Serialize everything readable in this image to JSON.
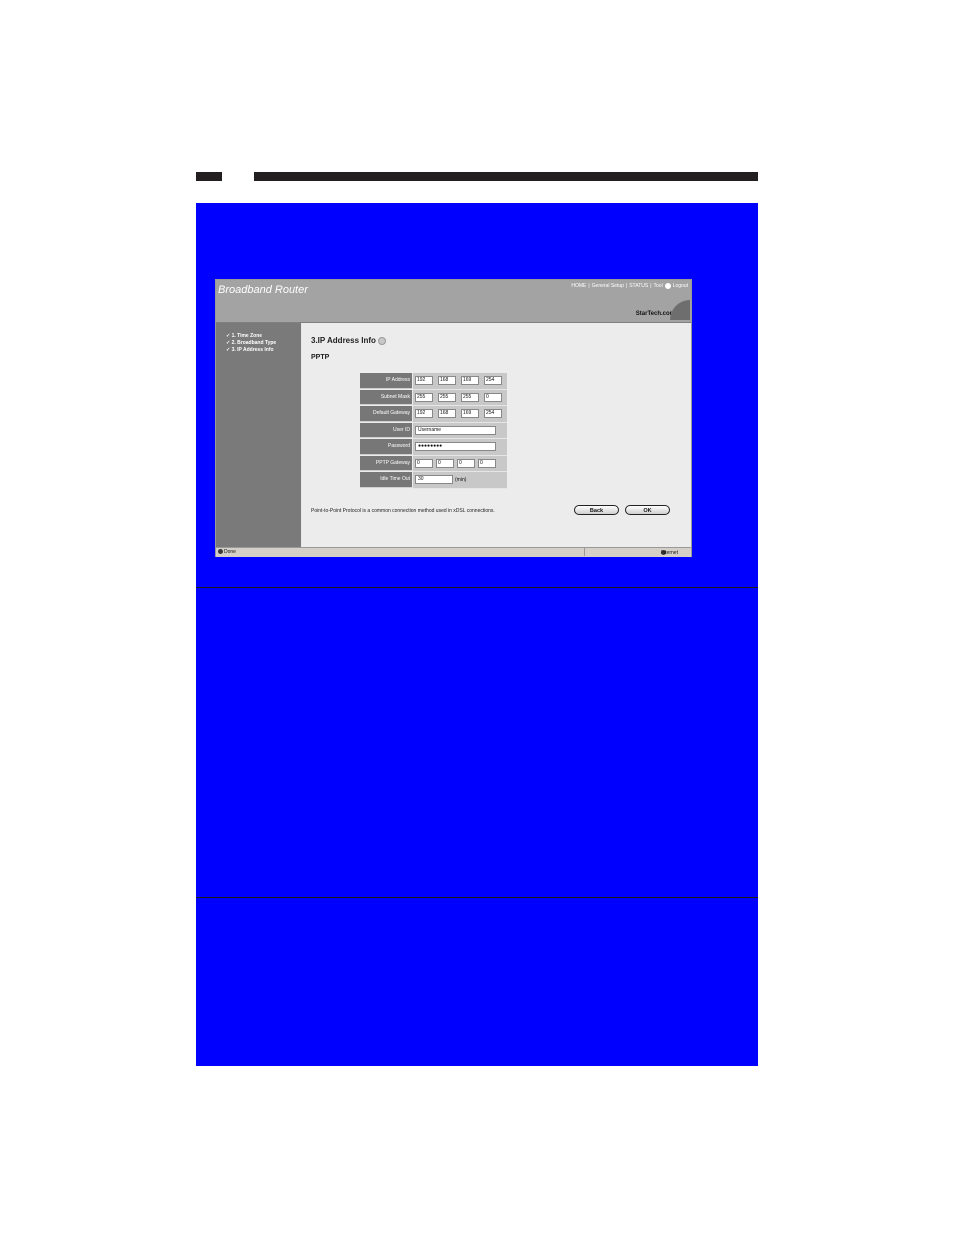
{
  "window": {
    "title": "Broadband Router",
    "nav": {
      "home": "HOME",
      "sep1": "|",
      "general_setup": "General Setup",
      "sep2": "|",
      "status": "STATUS",
      "sep3": "|",
      "tool": "Tool",
      "logout": "Logout"
    },
    "logo_text": "StarTech.com"
  },
  "sidebar": {
    "items": [
      {
        "label": "✓ 1. Time Zone"
      },
      {
        "label": "✓ 2. Broadband Type"
      },
      {
        "label": "✓ 3. IP Address Info"
      }
    ]
  },
  "main": {
    "heading": "3.IP Address Info",
    "section": "PPTP",
    "fields": {
      "ip_address": {
        "label": "IP Address",
        "octets": [
          "192",
          "168",
          "169",
          "254"
        ]
      },
      "subnet_mask": {
        "label": "Subnet Mask",
        "octets": [
          "255",
          "255",
          "255",
          "0"
        ]
      },
      "default_gateway": {
        "label": "Default Gateway",
        "octets": [
          "192",
          "168",
          "169",
          "254"
        ]
      },
      "user_id": {
        "label": "User ID",
        "value": "Username"
      },
      "password": {
        "label": "Password",
        "value": "●●●●●●●●"
      },
      "pptp_gateway": {
        "label": "PPTP Gateway",
        "octets": [
          "0",
          "0",
          "0",
          "0"
        ]
      },
      "idle_time_out": {
        "label": "Idle Time Out",
        "value": "30",
        "unit": "(min)"
      }
    },
    "description": "Point-to-Point Protocol is a common connection method used in xDSL connections.",
    "back_label": "Back",
    "ok_label": "OK"
  },
  "statusbar": {
    "left": "Done",
    "zone": "Internet"
  },
  "colors": {
    "background_panel": "#0000ff",
    "header": "#a3a3a3",
    "sidebar": "#7a7a7a",
    "label_cell": "#777777"
  }
}
